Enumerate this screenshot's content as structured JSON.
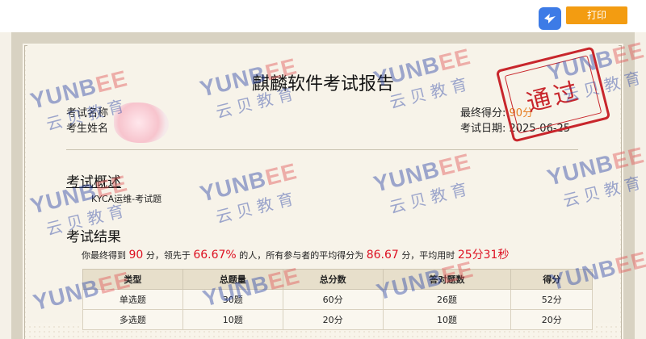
{
  "toolbar": {
    "print_label": "打印",
    "bird_icon": "dove-icon"
  },
  "report": {
    "title": "麒麟软件考试报告",
    "exam_name_label": "考试名称",
    "examinee_label": "考生姓名",
    "final_score_label": "最终得分:",
    "final_score_value": "90分",
    "exam_date_label": "考试日期:",
    "exam_date_value": "2025-06-25",
    "stamp_text": "通过"
  },
  "overview": {
    "heading": "考试概述",
    "text": "KYCA运维-考试题"
  },
  "results": {
    "heading": "考试结果",
    "summary": {
      "p1": "你最终得到",
      "score": "90",
      "p2": "分，领先于",
      "percent": "66.67%",
      "p3": "的人，所有参与者的平均得分为",
      "avg": "86.67",
      "p4": "分，平均用时",
      "time": "25分31秒"
    },
    "columns": [
      "类型",
      "总题量",
      "总分数",
      "答对题数",
      "得分"
    ],
    "rows": [
      [
        "单选题",
        "30题",
        "60分",
        "26题",
        "52分"
      ],
      [
        "多选题",
        "10题",
        "20分",
        "10题",
        "20分"
      ]
    ]
  },
  "watermark": {
    "brand_en_a": "YUNB",
    "brand_en_b": "EE",
    "brand_cn": "云贝教育"
  },
  "colors": {
    "accent_orange": "#f39c11",
    "stamp_red": "#c8262c",
    "watermark_blue": "#2f49a8",
    "icon_blue": "#3d7be6"
  }
}
